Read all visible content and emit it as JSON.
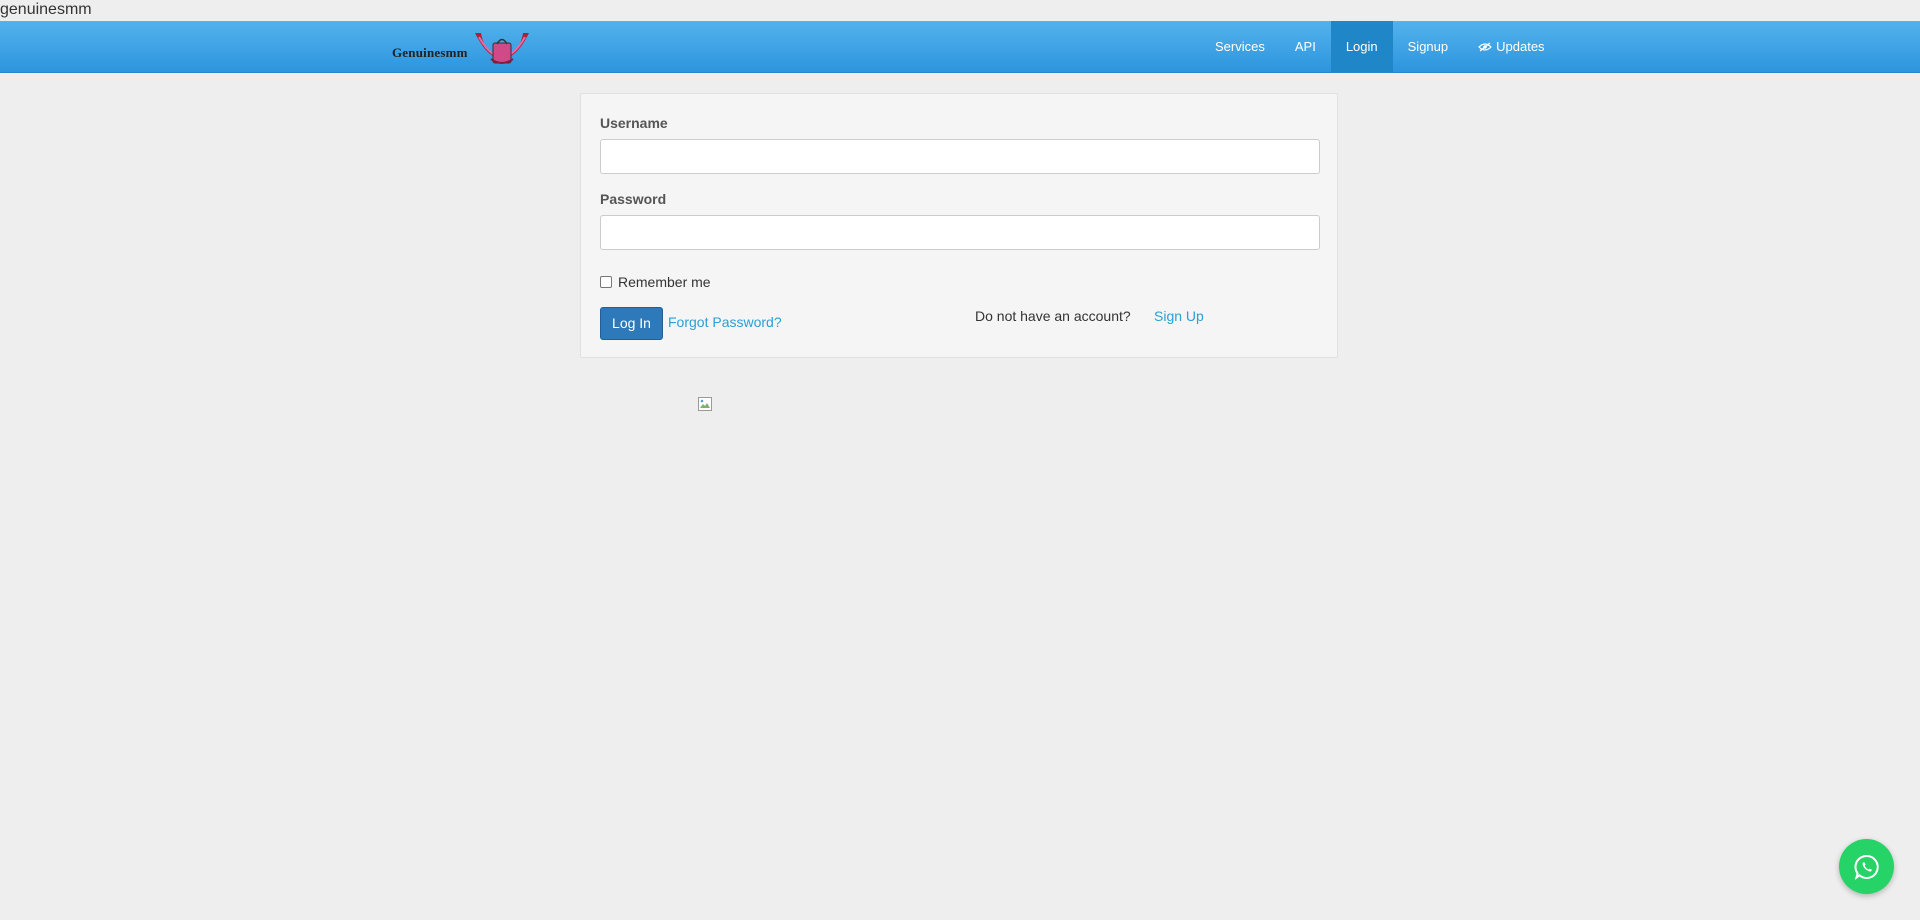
{
  "page": {
    "site_title": "genuinesmm"
  },
  "header": {
    "brand": "Genuinesmm",
    "nav": [
      {
        "label": "Services",
        "active": false
      },
      {
        "label": "API",
        "active": false
      },
      {
        "label": "Login",
        "active": true
      },
      {
        "label": "Signup",
        "active": false
      },
      {
        "label": "Updates",
        "active": false,
        "icon": "eye-slash-icon"
      }
    ]
  },
  "login_form": {
    "username_label": "Username",
    "username_value": "",
    "password_label": "Password",
    "password_value": "",
    "remember_label": "Remember me",
    "remember_checked": false,
    "login_button": "Log In",
    "forgot_link": "Forgot Password?",
    "no_account_text": "Do not have an account?",
    "signup_link": "Sign Up"
  },
  "floating": {
    "icon": "whatsapp-icon"
  },
  "colors": {
    "navbar": "#2d95de",
    "active_nav": "#1f86c8",
    "primary_button": "#2d79ba",
    "link": "#2a9fd8",
    "whatsapp": "#25d366"
  }
}
